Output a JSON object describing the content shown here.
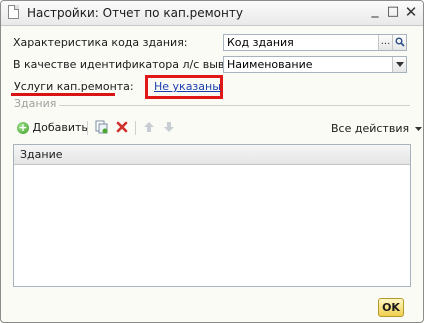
{
  "window": {
    "title": "Настройки: Отчет по кап.ремонту",
    "minimize_glyph": "_",
    "maximize_glyph": "□",
    "close_glyph": "✕"
  },
  "form": {
    "building_code": {
      "label": "Характеристика кода здания:",
      "value": "Код здания",
      "select_glyph": "...",
      "search_icon": "magnifier-icon"
    },
    "identifier": {
      "label": "В качестве идентификатора л/с выводить:",
      "value": "Наименование",
      "dropdown_icon": "chevron-down-icon"
    },
    "services": {
      "label": "Услуги кап.ремонта:",
      "link": "Не указаны"
    }
  },
  "buildings": {
    "group_title": "Здания",
    "toolbar": {
      "add_label": "Добавить",
      "all_actions_label": "Все действия",
      "icons": [
        "add-icon",
        "copy-icon",
        "delete-icon",
        "move-up-icon",
        "move-down-icon"
      ]
    },
    "columns": [
      "Здание"
    ],
    "rows": []
  },
  "footer": {
    "ok_label": "OK"
  },
  "colors": {
    "highlight_red": "#e01818",
    "link_blue": "#1a3fb0",
    "ok_button": "#f0cf4d"
  }
}
